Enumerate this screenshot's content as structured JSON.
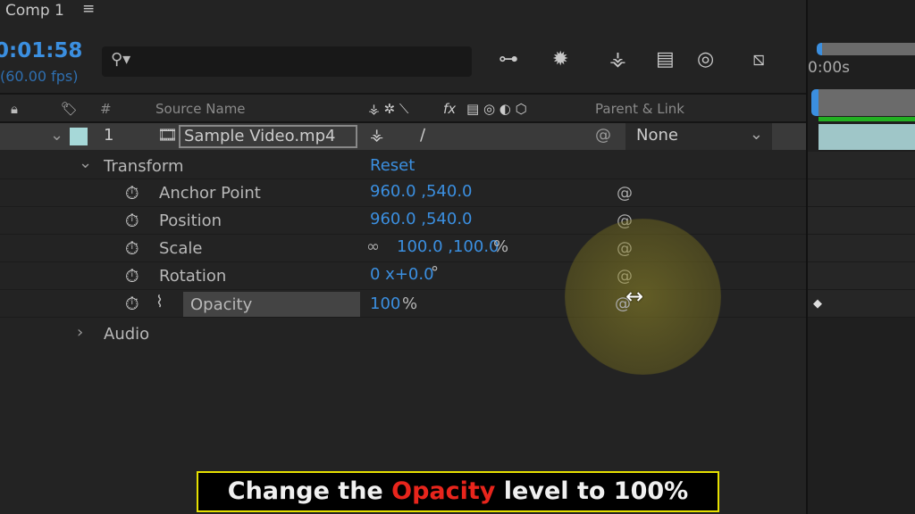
{
  "panel": {
    "title": "Comp 1",
    "menu_icon": "hamburger-icon"
  },
  "timecode": "0:01:58",
  "fps": "(60.00 fps)",
  "search": {
    "icon": "search-icon",
    "value": ""
  },
  "toolbar_icons": [
    "flowchart-icon",
    "draft-3d-icon",
    "shy-icon",
    "frame-blending-icon",
    "motion-blur-icon",
    "graph-editor-icon"
  ],
  "columns": {
    "number": "#",
    "source_name": "Source Name",
    "parent_link": "Parent & Link",
    "fx": "fx"
  },
  "layer": {
    "number": "1",
    "name": "Sample Video.mp4",
    "label_color": "#a6d8d8",
    "parent": "None"
  },
  "transform": {
    "label": "Transform",
    "reset": "Reset",
    "properties": [
      {
        "name": "Anchor Point",
        "value": "960.0 ,540.0",
        "unit": ""
      },
      {
        "name": "Position",
        "value": "960.0 ,540.0",
        "unit": ""
      },
      {
        "name": "Scale",
        "value": "100.0 ,100.0",
        "unit": "%"
      },
      {
        "name": "Rotation",
        "value": "0 x+0.0",
        "unit": "°"
      },
      {
        "name": "Opacity",
        "value": "100",
        "unit": "%",
        "stopwatch_active": true
      }
    ]
  },
  "audio": {
    "label": "Audio"
  },
  "timeline": {
    "ruler_label": "0:00s"
  },
  "caption": {
    "before": "Change the ",
    "highlight": "Opacity",
    "after": " level to 100%",
    "highlight_color": "#e8251c",
    "border_color": "#e6e000"
  }
}
